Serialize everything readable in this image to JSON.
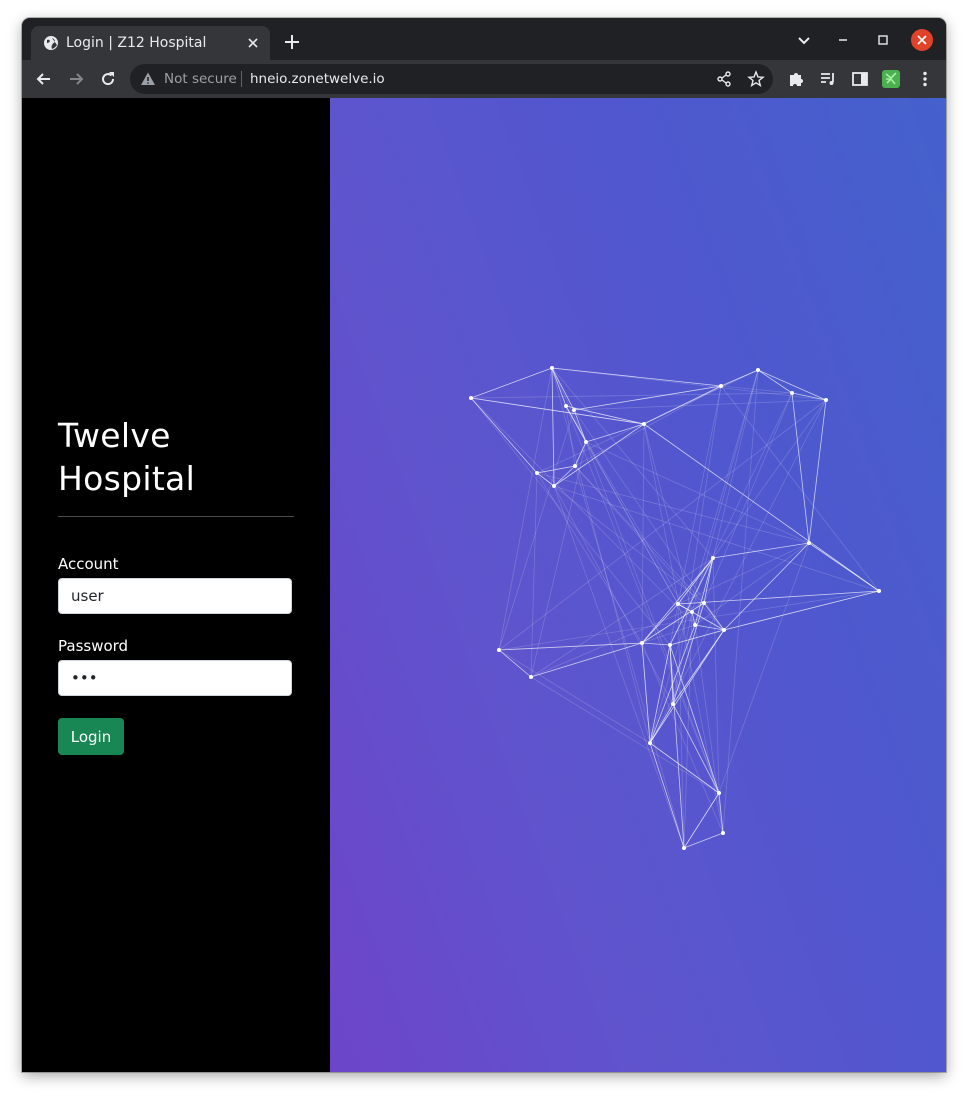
{
  "browser": {
    "tab_title": "Login | Z12 Hospital",
    "omnibox_security_label": "Not secure",
    "url": "hneio.zonetwelve.io",
    "icons": [
      "globe-icon",
      "close-icon",
      "plus-icon",
      "chevron-down-icon",
      "minimize-icon",
      "maximize-icon",
      "back-icon",
      "forward-icon",
      "reload-icon",
      "warning-icon",
      "share-icon",
      "star-icon",
      "puzzle-icon",
      "media-queue-icon",
      "side-panel-icon",
      "extension-icon",
      "more-vert-icon"
    ]
  },
  "sidebar": {
    "title_line1": "Twelve",
    "title_line2": "Hospital",
    "account_label": "Account",
    "account_value": "user",
    "password_label": "Password",
    "password_value": "•••",
    "login_label": "Login"
  },
  "colors": {
    "sidebar_bg": "#000000",
    "login_button": "#198754",
    "hero_gradient": [
      "#6d45c8",
      "#4461cc"
    ],
    "close_button": "#e0432a"
  }
}
